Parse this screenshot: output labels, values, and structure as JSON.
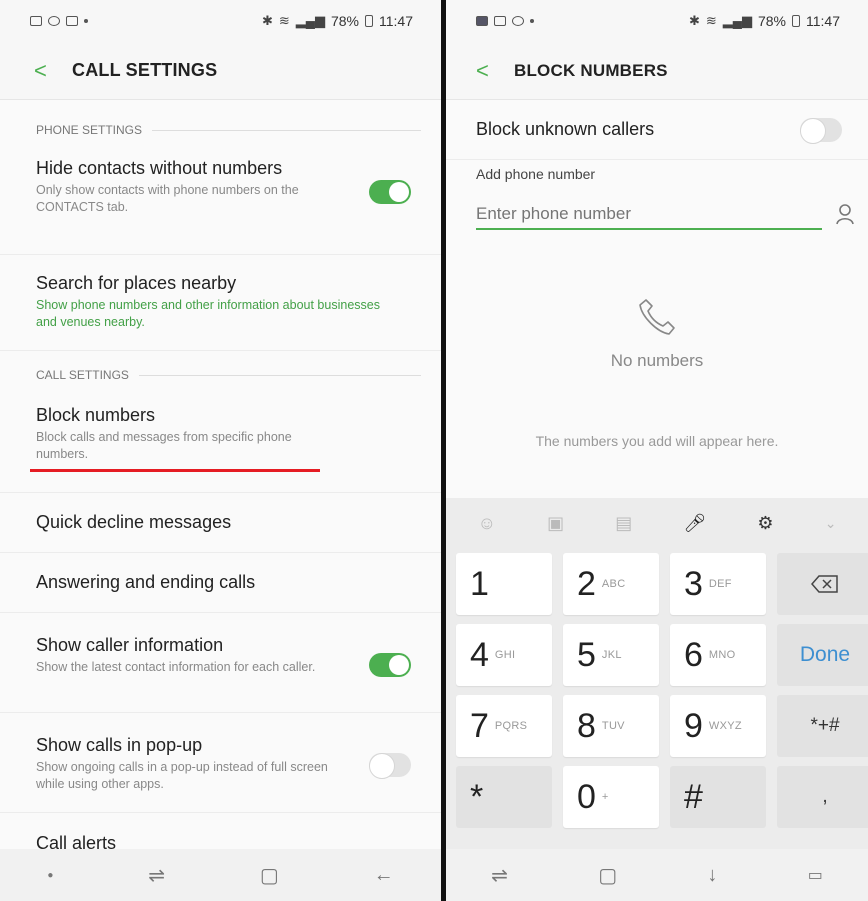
{
  "left": {
    "status": {
      "battery": "78%",
      "time": "11:47"
    },
    "header": {
      "back": "<",
      "title": "CALL SETTINGS"
    },
    "sections": {
      "phone": "PHONE SETTINGS",
      "call": "CALL SETTINGS"
    },
    "items": [
      {
        "title": "Hide contacts without numbers",
        "sub": "Only show contacts with phone numbers on the CONTACTS tab.",
        "toggle": "on"
      },
      {
        "title": "Search for places nearby",
        "sub": "Show phone numbers and other information about businesses and venues nearby."
      },
      {
        "title": "Block numbers",
        "sub": "Block calls and messages from specific phone numbers."
      },
      {
        "title": "Quick decline messages"
      },
      {
        "title": "Answering and ending calls"
      },
      {
        "title": "Show caller information",
        "sub": "Show the latest contact information for each caller.",
        "toggle": "on"
      },
      {
        "title": "Show calls in pop-up",
        "sub": "Show ongoing calls in a pop-up instead of full screen while using other apps.",
        "toggle": "off"
      },
      {
        "title": "Call alerts"
      }
    ]
  },
  "right": {
    "status": {
      "battery": "78%",
      "time": "11:47"
    },
    "header": {
      "back": "<",
      "title": "BLOCK NUMBERS"
    },
    "block_unknown": {
      "label": "Block unknown callers",
      "toggle": "off"
    },
    "add_label": "Add phone number",
    "input": {
      "placeholder": "Enter phone number",
      "value": ""
    },
    "empty": {
      "title": "No numbers",
      "hint": "The numbers you add will appear here."
    },
    "keys": [
      {
        "num": "1",
        "let": ""
      },
      {
        "num": "2",
        "let": "ABC"
      },
      {
        "num": "3",
        "let": "DEF"
      },
      {
        "num": "4",
        "let": "GHI"
      },
      {
        "num": "5",
        "let": "JKL"
      },
      {
        "num": "6",
        "let": "MNO"
      },
      {
        "num": "7",
        "let": "PQRS"
      },
      {
        "num": "8",
        "let": "TUV"
      },
      {
        "num": "9",
        "let": "WXYZ"
      },
      {
        "num": "*",
        "let": ""
      },
      {
        "num": "0",
        "let": "+"
      },
      {
        "num": "#",
        "let": ""
      }
    ],
    "done_label": "Done",
    "symbols_label": "*+#",
    "comma_label": ","
  },
  "colors": {
    "accent": "#4caf50",
    "highlight": "#e51c23",
    "done": "#3d8fd1"
  }
}
